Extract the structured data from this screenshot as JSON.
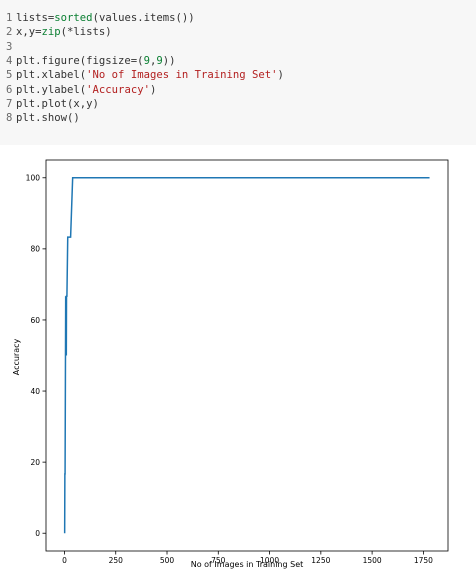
{
  "code": {
    "lines": [
      {
        "num": "1",
        "segs": [
          {
            "t": "lists=",
            "c": ""
          },
          {
            "t": "sorted",
            "c": "kw-green"
          },
          {
            "t": "(values.items())",
            "c": ""
          }
        ]
      },
      {
        "num": "2",
        "segs": [
          {
            "t": "x,y=",
            "c": ""
          },
          {
            "t": "zip",
            "c": "kw-green"
          },
          {
            "t": "(*lists)",
            "c": ""
          }
        ]
      },
      {
        "num": "3",
        "segs": []
      },
      {
        "num": "4",
        "segs": [
          {
            "t": "plt.figure(figsize=(",
            "c": ""
          },
          {
            "t": "9",
            "c": "num"
          },
          {
            "t": ",",
            "c": ""
          },
          {
            "t": "9",
            "c": "num"
          },
          {
            "t": "))",
            "c": ""
          }
        ]
      },
      {
        "num": "5",
        "segs": [
          {
            "t": "plt.xlabel(",
            "c": ""
          },
          {
            "t": "'No of Images in Training Set'",
            "c": "str"
          },
          {
            "t": ")",
            "c": ""
          }
        ]
      },
      {
        "num": "6",
        "segs": [
          {
            "t": "plt.ylabel(",
            "c": ""
          },
          {
            "t": "'Accuracy'",
            "c": "str"
          },
          {
            "t": ")",
            "c": ""
          }
        ]
      },
      {
        "num": "7",
        "segs": [
          {
            "t": "plt.plot(x,y)",
            "c": ""
          }
        ]
      },
      {
        "num": "8",
        "segs": [
          {
            "t": "plt.show()",
            "c": ""
          }
        ]
      }
    ]
  },
  "chart_data": {
    "type": "line",
    "title": "",
    "xlabel": "No of Images in Training Set",
    "ylabel": "Accuracy",
    "xlim": [
      -90,
      1870
    ],
    "ylim": [
      -5,
      105
    ],
    "xticks": [
      0,
      250,
      500,
      750,
      1000,
      1250,
      1500,
      1750
    ],
    "yticks": [
      0,
      20,
      40,
      60,
      80,
      100
    ],
    "grid": false,
    "line_color": "#1f77b4",
    "series": [
      {
        "x": [
          1,
          2,
          3,
          4,
          5,
          6,
          7,
          8,
          9,
          10,
          12,
          16,
          20,
          24,
          30,
          40,
          50,
          100,
          500,
          1000,
          1500,
          1780
        ],
        "y": [
          0,
          16.7,
          16.7,
          33.3,
          50,
          66.7,
          50,
          66.7,
          50,
          66.7,
          66.7,
          83.3,
          83.3,
          83.3,
          83.3,
          100,
          100,
          100,
          100,
          100,
          100,
          100
        ]
      }
    ]
  }
}
